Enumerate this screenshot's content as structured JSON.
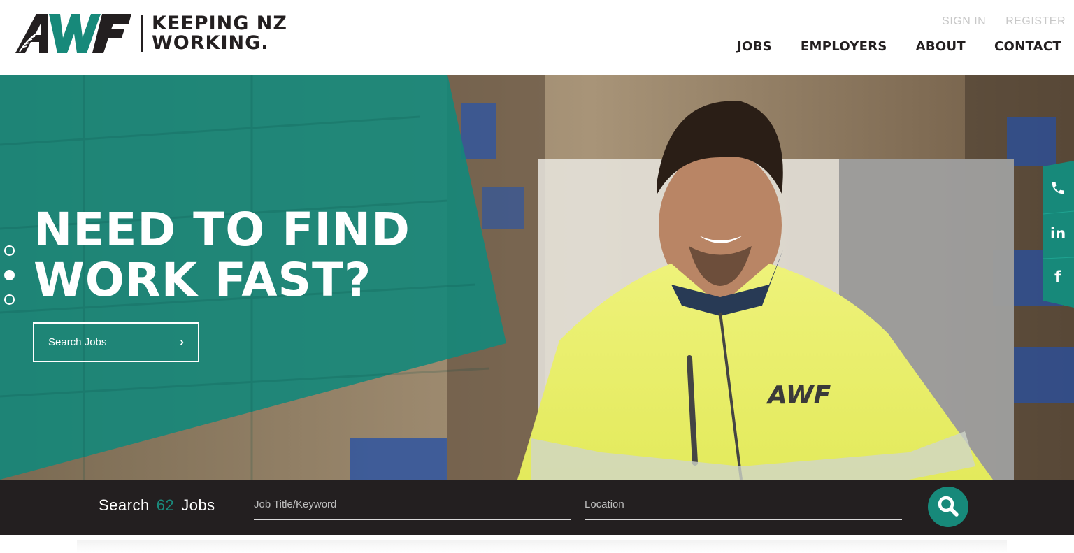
{
  "brand": {
    "logo_text": "AWF",
    "tagline_line1": "KEEPING NZ",
    "tagline_line2": "WORKING.",
    "accent_color": "#17897a",
    "dark_color": "#231f20"
  },
  "utility_nav": {
    "sign_in": "SIGN IN",
    "register": "REGISTER"
  },
  "main_nav": {
    "items": [
      "JOBS",
      "EMPLOYERS",
      "ABOUT",
      "CONTACT"
    ]
  },
  "hero": {
    "title_line1": "NEED TO FIND",
    "title_line2": "WORK FAST?",
    "cta_label": "Search Jobs",
    "cta_icon": "chevron-right-icon",
    "slide_count": 3,
    "active_slide": 2,
    "jacket_logo": "AWF"
  },
  "social": {
    "items": [
      "phone-icon",
      "linkedin-icon",
      "facebook-icon"
    ],
    "linkedin_label": "in",
    "facebook_label": "f"
  },
  "search": {
    "label_prefix": "Search",
    "job_count": "62",
    "label_suffix": "Jobs",
    "keyword_placeholder": "Job Title/Keyword",
    "location_placeholder": "Location",
    "button_icon": "search-icon"
  }
}
